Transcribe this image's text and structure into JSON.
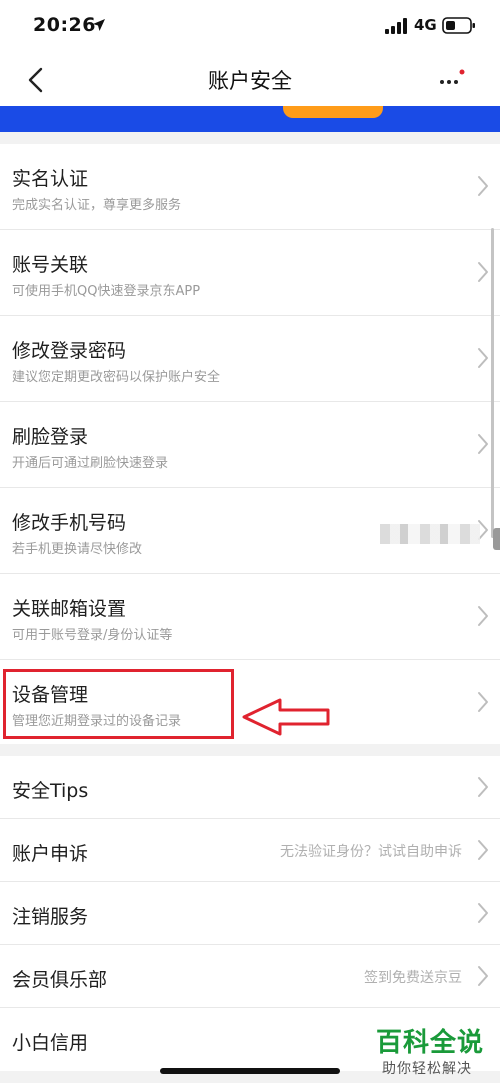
{
  "status_bar": {
    "time": "20:26",
    "network": "4G"
  },
  "nav": {
    "title": "账户安全"
  },
  "colors": {
    "banner": "#1a4be6",
    "banner_button": "#ff9c19",
    "highlight": "#e0232f",
    "accent_dot": "#e0232f",
    "watermark": "#1a9a3a"
  },
  "groups": {
    "primary": [
      {
        "title": "实名认证",
        "subtitle": "完成实名认证，尊享更多服务"
      },
      {
        "title": "账号关联",
        "subtitle": "可使用手机QQ快速登录京东APP"
      },
      {
        "title": "修改登录密码",
        "subtitle": "建议您定期更改密码以保护账户安全"
      },
      {
        "title": "刷脸登录",
        "subtitle": "开通后可通过刷脸快速登录"
      },
      {
        "title": "修改手机号码",
        "subtitle": "若手机更换请尽快修改"
      },
      {
        "title": "关联邮箱设置",
        "subtitle": "可用于账号登录/身份认证等"
      },
      {
        "title": "设备管理",
        "subtitle": "管理您近期登录过的设备记录"
      }
    ],
    "secondary": [
      {
        "title": "安全Tips",
        "hint": ""
      },
      {
        "title": "账户申诉",
        "hint": "无法验证身份？试试自助申诉"
      },
      {
        "title": "注销服务",
        "hint": ""
      },
      {
        "title": "会员俱乐部",
        "hint": "签到免费送京豆"
      },
      {
        "title": "小白信用",
        "hint": ""
      }
    ]
  },
  "watermark": {
    "main": "百科全说",
    "sub": "助你轻松解决"
  },
  "icons": [
    "location-arrow-icon",
    "signal-bars-icon",
    "battery-icon",
    "back-chevron-icon",
    "more-dots-icon",
    "chevron-right-icon",
    "red-arrow-icon"
  ]
}
